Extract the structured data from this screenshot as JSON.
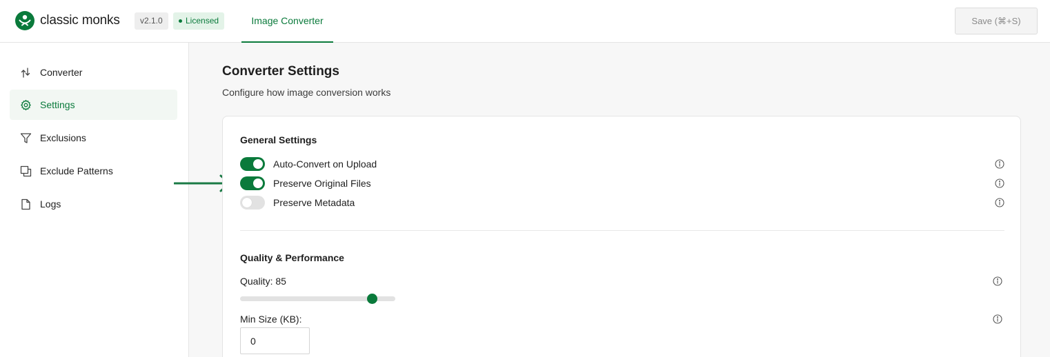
{
  "header": {
    "brand": "classic monks",
    "version": "v2.1.0",
    "license_badge": "Licensed",
    "tab": "Image Converter",
    "save_label": "Save (⌘+S)"
  },
  "sidebar": {
    "items": [
      {
        "label": "Converter",
        "icon": "convert-arrows-icon"
      },
      {
        "label": "Settings",
        "icon": "gear-icon",
        "active": true
      },
      {
        "label": "Exclusions",
        "icon": "filter-icon"
      },
      {
        "label": "Exclude Patterns",
        "icon": "copy-icon"
      },
      {
        "label": "Logs",
        "icon": "file-icon"
      }
    ]
  },
  "main": {
    "title": "Converter Settings",
    "subtitle": "Configure how image conversion works",
    "general": {
      "title": "General Settings",
      "toggles": [
        {
          "label": "Auto-Convert on Upload",
          "on": true
        },
        {
          "label": "Preserve Original Files",
          "on": true
        },
        {
          "label": "Preserve Metadata",
          "on": false
        }
      ]
    },
    "quality": {
      "title": "Quality & Performance",
      "quality_label": "Quality: 85",
      "quality_value": 85,
      "min_size_label": "Min Size (KB):",
      "min_size_value": "0"
    }
  },
  "colors": {
    "accent": "#0a7a3b",
    "accent_bg": "#e3f3e8"
  }
}
